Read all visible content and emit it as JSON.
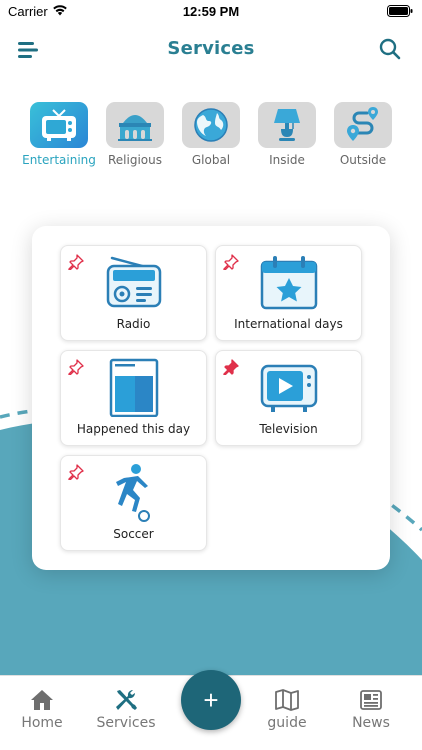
{
  "status_bar": {
    "carrier": "Carrier",
    "time": "12:59 PM"
  },
  "header": {
    "title": "Services",
    "menu_icon": "hamburger-menu-icon",
    "search_icon": "search-icon"
  },
  "categories": [
    {
      "label": "Entertaining",
      "icon": "tv-icon",
      "active": true
    },
    {
      "label": "Religious",
      "icon": "mosque-icon",
      "active": false
    },
    {
      "label": "Global",
      "icon": "globe-icon",
      "active": false
    },
    {
      "label": "Inside",
      "icon": "lamp-icon",
      "active": false
    },
    {
      "label": "Outside",
      "icon": "route-icon",
      "active": false
    }
  ],
  "services": [
    {
      "name": "Radio",
      "icon": "radio-icon",
      "pinned": false
    },
    {
      "name": "International days",
      "icon": "calendar-star-icon",
      "pinned": false
    },
    {
      "name": "Happened this day",
      "icon": "document-icon",
      "pinned": false
    },
    {
      "name": "Television",
      "icon": "tv-play-icon",
      "pinned": true
    },
    {
      "name": "Soccer",
      "icon": "soccer-player-icon",
      "pinned": false
    }
  ],
  "fab": {
    "label": "+"
  },
  "tabbar": [
    {
      "label": "Home",
      "icon": "home-icon",
      "active": false
    },
    {
      "label": "Services",
      "icon": "tools-icon",
      "active": true
    },
    {
      "label": "guide",
      "icon": "map-icon",
      "active": false
    },
    {
      "label": "News",
      "icon": "newspaper-icon",
      "active": false
    }
  ],
  "colors": {
    "accent": "#2a7f92",
    "wave": "#58a7bb",
    "fab": "#1e6678",
    "pin": "#e0304a"
  }
}
